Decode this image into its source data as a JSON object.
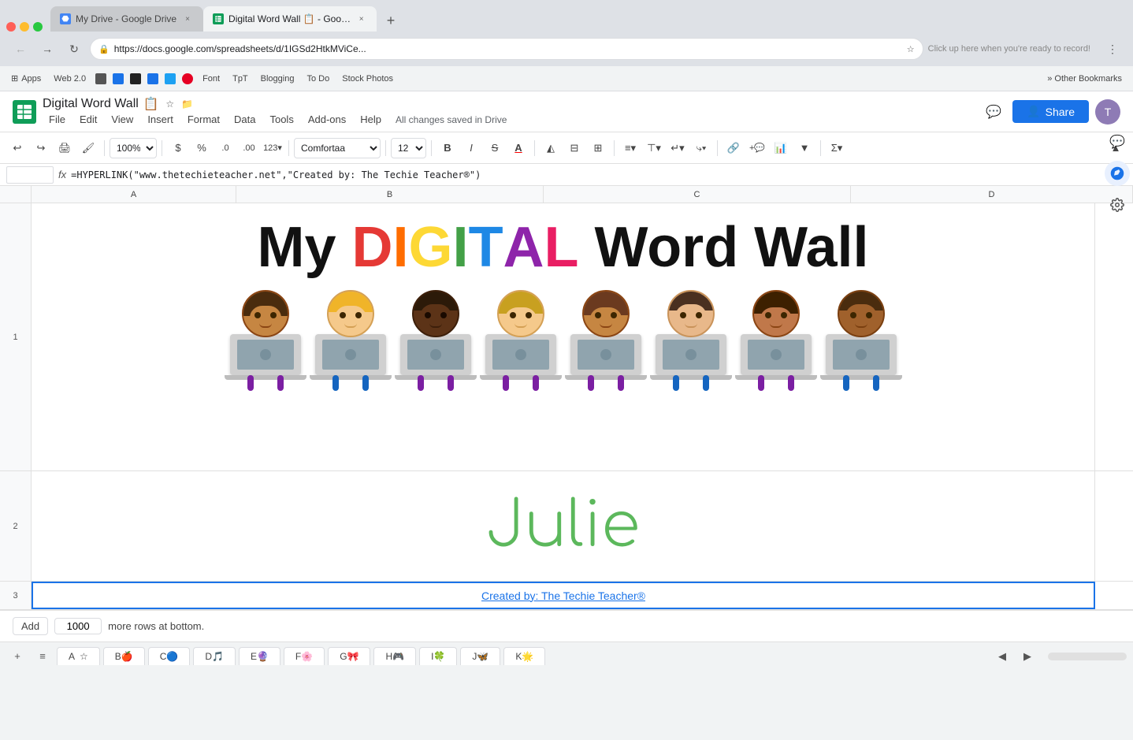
{
  "browser": {
    "tabs": [
      {
        "id": "tab-drive",
        "title": "My Drive - Google Drive",
        "favicon_color": "#4285f4",
        "active": false
      },
      {
        "id": "tab-sheets",
        "title": "Digital Word Wall 📋 - Google...",
        "favicon_color": "#0f9d58",
        "active": true
      }
    ],
    "new_tab_label": "+",
    "address": "https://docs.google.com/spreadsheets/d/1IGSd2HtkMViCe...",
    "record_hint": "Click up here when you're ready to record!"
  },
  "bookmarks": [
    {
      "label": "Apps"
    },
    {
      "label": "Web 2.0"
    },
    {
      "label": "Font"
    },
    {
      "label": "TpT"
    },
    {
      "label": "Blogging"
    },
    {
      "label": "To Do"
    },
    {
      "label": "Stock Photos"
    },
    {
      "label": "» Other Bookmarks"
    }
  ],
  "app_header": {
    "title": "Digital Word Wall",
    "autosave": "All changes saved in Drive",
    "menu_items": [
      "File",
      "Edit",
      "View",
      "Insert",
      "Format",
      "Data",
      "Tools",
      "Add-ons",
      "Help"
    ],
    "share_label": "Share",
    "comment_icon": "💬"
  },
  "toolbar": {
    "zoom": "100%",
    "currency": "$",
    "percent": "%",
    "decimal1": ".0",
    "decimal2": ".00",
    "more_formats": "123▾",
    "font": "Comfortaa",
    "font_size": "12",
    "bold": "B",
    "italic": "I",
    "strikethrough": "S",
    "text_color": "A",
    "fill_color": "◭",
    "borders": "⊟",
    "merge": "⊞",
    "text_align": "≡",
    "valign": "⊤",
    "wrap": "↵",
    "rotate": "⤷",
    "link": "🔗",
    "comment": "+💬",
    "chart": "📊",
    "filter": "▼",
    "functions": "Σ"
  },
  "formula_bar": {
    "cell_ref": "",
    "formula": "=HYPERLINK(\"www.thetechieteacher.net\",\"Created by: The Techie Teacher®\")"
  },
  "spreadsheet": {
    "col_headers": [
      "A",
      "B",
      "C",
      "D"
    ],
    "rows": {
      "row1_num": "1",
      "row2_num": "2",
      "row3_num": "3"
    },
    "title": {
      "my": "My ",
      "digital_letters": [
        "D",
        "I",
        "G",
        "I",
        "T",
        "A",
        "L"
      ],
      "word": " Word Wall"
    },
    "name": "Julie",
    "created_by_text": "Created by: The Techie Teacher®",
    "created_by_link": "Created by: The Techie Teacher®"
  },
  "add_rows": {
    "button_label": "Add",
    "rows_count": "1000",
    "suffix_text": "more rows at bottom."
  },
  "sheet_tabs": [
    {
      "label": "A☆"
    },
    {
      "label": "B🍎"
    },
    {
      "label": "C🔵"
    },
    {
      "label": "D🎵"
    },
    {
      "label": "E🔮"
    },
    {
      "label": "F🌸"
    },
    {
      "label": "G🎀"
    },
    {
      "label": "H🎮"
    },
    {
      "label": "I🍀"
    },
    {
      "label": "J🦋"
    },
    {
      "label": "K🌟"
    }
  ],
  "right_sidebar": {
    "icons": [
      "💬",
      "🌐",
      "⚙"
    ]
  },
  "students": [
    {
      "emoji": "👩‍💻",
      "skin": "medium-dark"
    },
    {
      "emoji": "👦‍💻",
      "skin": "medium-light"
    },
    {
      "emoji": "👨‍💻",
      "skin": "dark"
    },
    {
      "emoji": "👧‍💻",
      "skin": "medium-light-blonde"
    },
    {
      "emoji": "👩‍💻",
      "skin": "medium-dark-2"
    },
    {
      "emoji": "👨‍💻",
      "skin": "medium"
    },
    {
      "emoji": "👩‍💻",
      "skin": "medium-dark-3"
    },
    {
      "emoji": "👨‍💻",
      "skin": "medium-dark-4"
    }
  ]
}
